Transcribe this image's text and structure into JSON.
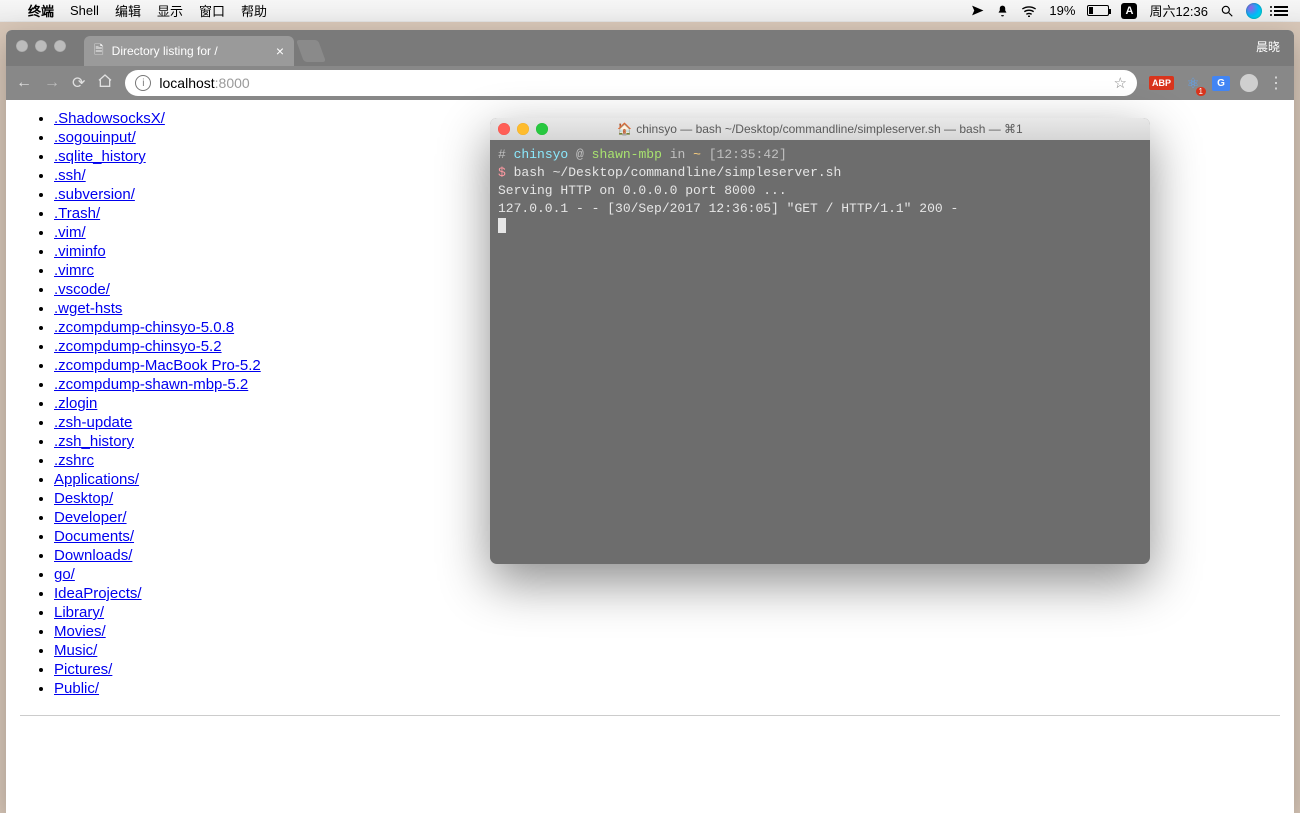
{
  "menubar": {
    "apple": "",
    "app": "终端",
    "items": [
      "Shell",
      "编辑",
      "显示",
      "窗口",
      "帮助"
    ],
    "battery_text": "19%",
    "ime": "A",
    "clock": "周六12:36",
    "right_user": "晨晓"
  },
  "browser": {
    "tab_title": "Directory listing for /",
    "url_host": "localhost",
    "url_port": ":8000",
    "ext_abp": "ABP",
    "ext_react_badge": "1",
    "ext_gt": "G",
    "listing": [
      ".ShadowsocksX/",
      ".sogouinput/",
      ".sqlite_history",
      ".ssh/",
      ".subversion/",
      ".Trash/",
      ".vim/",
      ".viminfo",
      ".vimrc",
      ".vscode/",
      ".wget-hsts",
      ".zcompdump-chinsyo-5.0.8",
      ".zcompdump-chinsyo-5.2",
      ".zcompdump-MacBook Pro-5.2",
      ".zcompdump-shawn-mbp-5.2",
      ".zlogin",
      ".zsh-update",
      ".zsh_history",
      ".zshrc",
      "Applications/",
      "Desktop/",
      "Developer/",
      "Documents/",
      "Downloads/",
      "go/",
      "IdeaProjects/",
      "Library/",
      "Movies/",
      "Music/",
      "Pictures/",
      "Public/"
    ]
  },
  "terminal": {
    "title": "chinsyo — bash ~/Desktop/commandline/simpleserver.sh — bash — ⌘1",
    "prompt_user": "chinsyo",
    "prompt_host": "shawn-mbp",
    "prompt_in": "in",
    "prompt_dir": "~",
    "prompt_time": "[12:35:42]",
    "prompt_hash": "#",
    "prompt_at": "@",
    "prompt_dollar": "$",
    "cmd": "bash ~/Desktop/commandline/simpleserver.sh",
    "line_serving": "Serving HTTP on 0.0.0.0 port 8000 ...",
    "line_log": "127.0.0.1 - - [30/Sep/2017 12:36:05] \"GET / HTTP/1.1\" 200 -"
  }
}
